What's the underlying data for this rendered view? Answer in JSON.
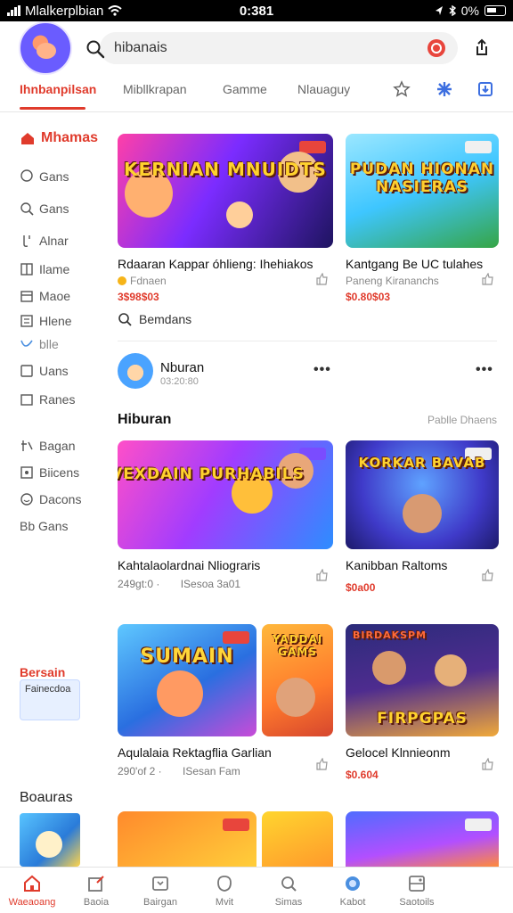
{
  "status_bar": {
    "carrier": "Mlalkerplbian",
    "time": "0:381",
    "battery_text": "0%"
  },
  "header": {
    "search_value": "hibanais"
  },
  "tabs": [
    {
      "label": "Ihnbanpilsan",
      "active": true
    },
    {
      "label": "Mibllkrapan",
      "active": false
    },
    {
      "label": "Gamme",
      "active": false
    },
    {
      "label": "Nlauaguy",
      "active": false
    }
  ],
  "sidebar": {
    "heading": "Mhamas",
    "items": [
      "Gans",
      "Gans",
      "Alnar",
      "Ilame",
      "Maoe",
      "Hlene",
      "blle",
      "Uans",
      "Ranes",
      "Bagan",
      "Biicens",
      "Dacons",
      "Bb Gans"
    ],
    "promo_title": "Bersain",
    "promo_card": "Fainecdoa",
    "section": "Boauras"
  },
  "feed": {
    "row1": [
      {
        "title": "Rdaaran Kappar óhlieng: Ihehiakos",
        "sub": "Fdnaen",
        "price": "3$98$03",
        "art_text": "KERNIAN MNUIDTS"
      },
      {
        "title": "Kantgang Be UC tulahes",
        "sub": "Paneng Kirananchs",
        "price": "$0.80$03",
        "art_text": "PUDAN HIONAN NASIERAS"
      }
    ],
    "search_suggestion": "Bemdans",
    "profile": {
      "name": "Nburan",
      "time": "03:20:80"
    },
    "section_title": "Hiburan",
    "section_link": "Pablle Dhaens",
    "row2": [
      {
        "title": "Kahtalaolardnai Nliograris",
        "meta_left": "249gt:0 ·",
        "meta_right": "ISesoa 3a01",
        "art_text": "VEXDAIN PURHABILS"
      },
      {
        "title": "Kanibban Raltoms",
        "price": "$0a00",
        "art_text": "KORKAR BAVAB"
      }
    ],
    "row3": [
      {
        "title": "Aqulalaia Rektagflia Garlian",
        "meta_left": "290'of 2 ·",
        "meta_right": "ISesan Fam",
        "art_text": "SUMAIN",
        "art_text2": "YADDAI GAMS"
      },
      {
        "title": "Gelocel Klnnieonm",
        "price": "$0.604",
        "art_text": "FIRPGPAS",
        "art_text2": "BIRDAKSPM"
      }
    ]
  },
  "bottom_nav": [
    {
      "label": "Waeaoang",
      "active": true
    },
    {
      "label": "Baoia",
      "active": false
    },
    {
      "label": "Bairgan",
      "active": false
    },
    {
      "label": "Mvit",
      "active": false
    },
    {
      "label": "Simas",
      "active": false
    },
    {
      "label": "Kabot",
      "active": false
    },
    {
      "label": "Saotoils",
      "active": false
    }
  ],
  "colors": {
    "accent": "#e03b2c",
    "text": "#1c1c1c",
    "muted": "#888888"
  }
}
